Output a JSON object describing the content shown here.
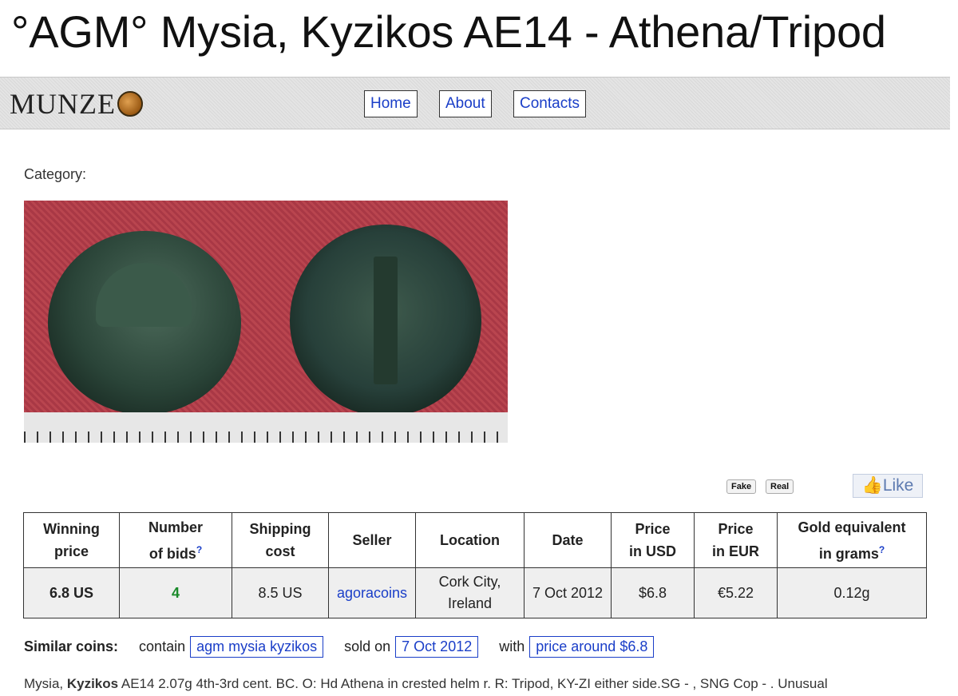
{
  "title": "°AGM° Mysia, Kyzikos AE14 - Athena/Tripod",
  "logo": {
    "text": "MUNZE",
    "icon": "coin-icon"
  },
  "nav": {
    "home": "Home",
    "about": "About",
    "contacts": "Contacts"
  },
  "category_label": "Category:",
  "image": {
    "description_icon": "coin-photo"
  },
  "buttons": {
    "fake": "Fake",
    "real": "Real",
    "like": "Like"
  },
  "table": {
    "headers": {
      "winning_price": [
        "Winning",
        "price"
      ],
      "bids": [
        "Number",
        "of bids"
      ],
      "shipping": [
        "Shipping",
        "cost"
      ],
      "seller": "Seller",
      "location": "Location",
      "date": "Date",
      "price_usd": [
        "Price",
        "in USD"
      ],
      "price_eur": [
        "Price",
        "in EUR"
      ],
      "gold": [
        "Gold equivalent",
        "in grams"
      ]
    },
    "help_mark": "?",
    "row": {
      "winning_price": "6.8 US",
      "bids": "4",
      "shipping": "8.5 US",
      "seller": "agoracoins",
      "location": [
        "Cork City,",
        "Ireland"
      ],
      "date": "7 Oct 2012",
      "price_usd": "$6.8",
      "price_eur": "€5.22",
      "gold": "0.12g"
    }
  },
  "similar": {
    "label": "Similar coins:",
    "contain_text": "contain",
    "contain_value": "agm mysia kyzikos",
    "sold_text": "sold on",
    "sold_value": "7 Oct 2012",
    "with_text": "with",
    "with_value": "price around $6.8"
  },
  "description": {
    "prefix": "Mysia, ",
    "bold": "Kyzikos",
    "rest": " AE14 2.07g 4th-3rd cent. BC. O: Hd Athena in crested helm r. R: Tripod, KY-ZI either side.SG - , SNG Cop - . Unusual"
  }
}
